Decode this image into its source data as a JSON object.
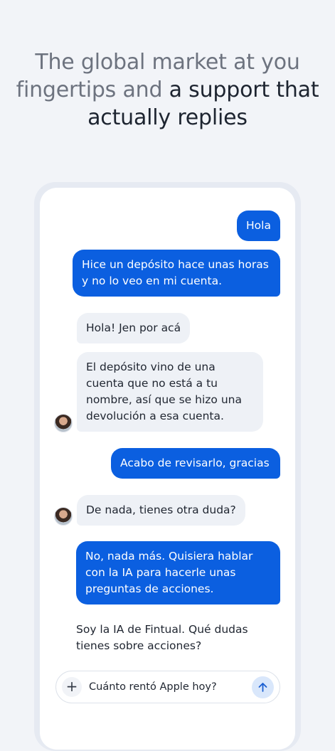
{
  "headline": {
    "line1": "The global market at you",
    "line2_light": "fingertips and",
    "line2_strong": "a support that",
    "line3_strong": "actually replies"
  },
  "chat": {
    "messages": [
      {
        "from": "user",
        "text": "Hola"
      },
      {
        "from": "user",
        "text": "Hice un depósito hace unas horas y no lo veo en mi cuenta."
      },
      {
        "from": "agent",
        "text": "Hola! Jen por acá"
      },
      {
        "from": "agent",
        "text": "El depósito vino de una cuenta que no está a tu nombre, así que se hizo una devolución a esa cuenta."
      },
      {
        "from": "user",
        "text": "Acabo de revisarlo, gracias"
      },
      {
        "from": "agent",
        "text": "De nada, tienes otra duda?"
      },
      {
        "from": "user",
        "text": "No, nada más. Quisiera hablar con la IA para hacerle unas preguntas de acciones."
      },
      {
        "from": "ai",
        "text": "Soy la IA de Fintual. Qué dudas tienes sobre acciones?"
      }
    ],
    "composer": {
      "value": "Cuánto rentó Apple hoy?",
      "plus_icon": "plus-icon",
      "send_icon": "arrow-up-icon"
    }
  },
  "colors": {
    "background": "#f2f4f8",
    "user_bubble": "#0b5fe0",
    "agent_bubble": "#eef1f6",
    "send_button": "#d9e7fb"
  }
}
